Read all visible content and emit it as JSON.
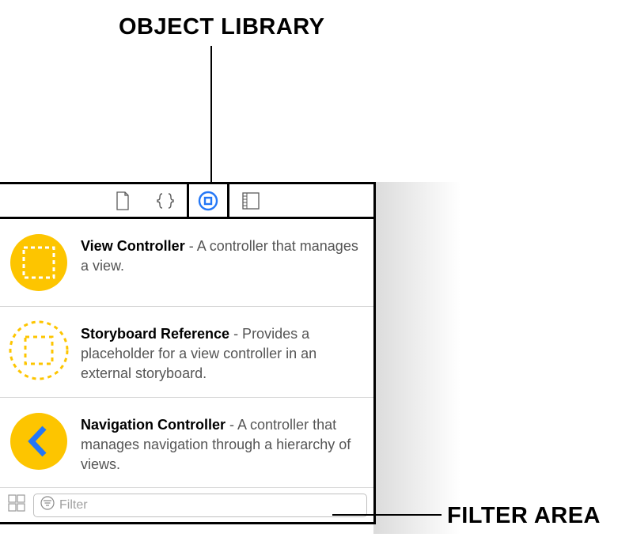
{
  "annotations": {
    "top": "OBJECT LIBRARY",
    "right": "FILTER AREA"
  },
  "toolbar": {
    "tabs": [
      {
        "name": "file-template",
        "selected": false
      },
      {
        "name": "code-snippets",
        "selected": false
      },
      {
        "name": "object-library",
        "selected": true
      },
      {
        "name": "media-library",
        "selected": false
      }
    ]
  },
  "items": [
    {
      "title": "View Controller",
      "desc": " - A controller that manages a view.",
      "icon": "view-controller"
    },
    {
      "title": "Storyboard Reference",
      "desc": " - Provides a placeholder for a view controller in an external storyboard.",
      "icon": "storyboard-reference"
    },
    {
      "title": "Navigation Controller",
      "desc": " - A controller that manages navigation through a hierarchy of views.",
      "icon": "navigation-controller"
    }
  ],
  "filter": {
    "placeholder": "Filter"
  }
}
